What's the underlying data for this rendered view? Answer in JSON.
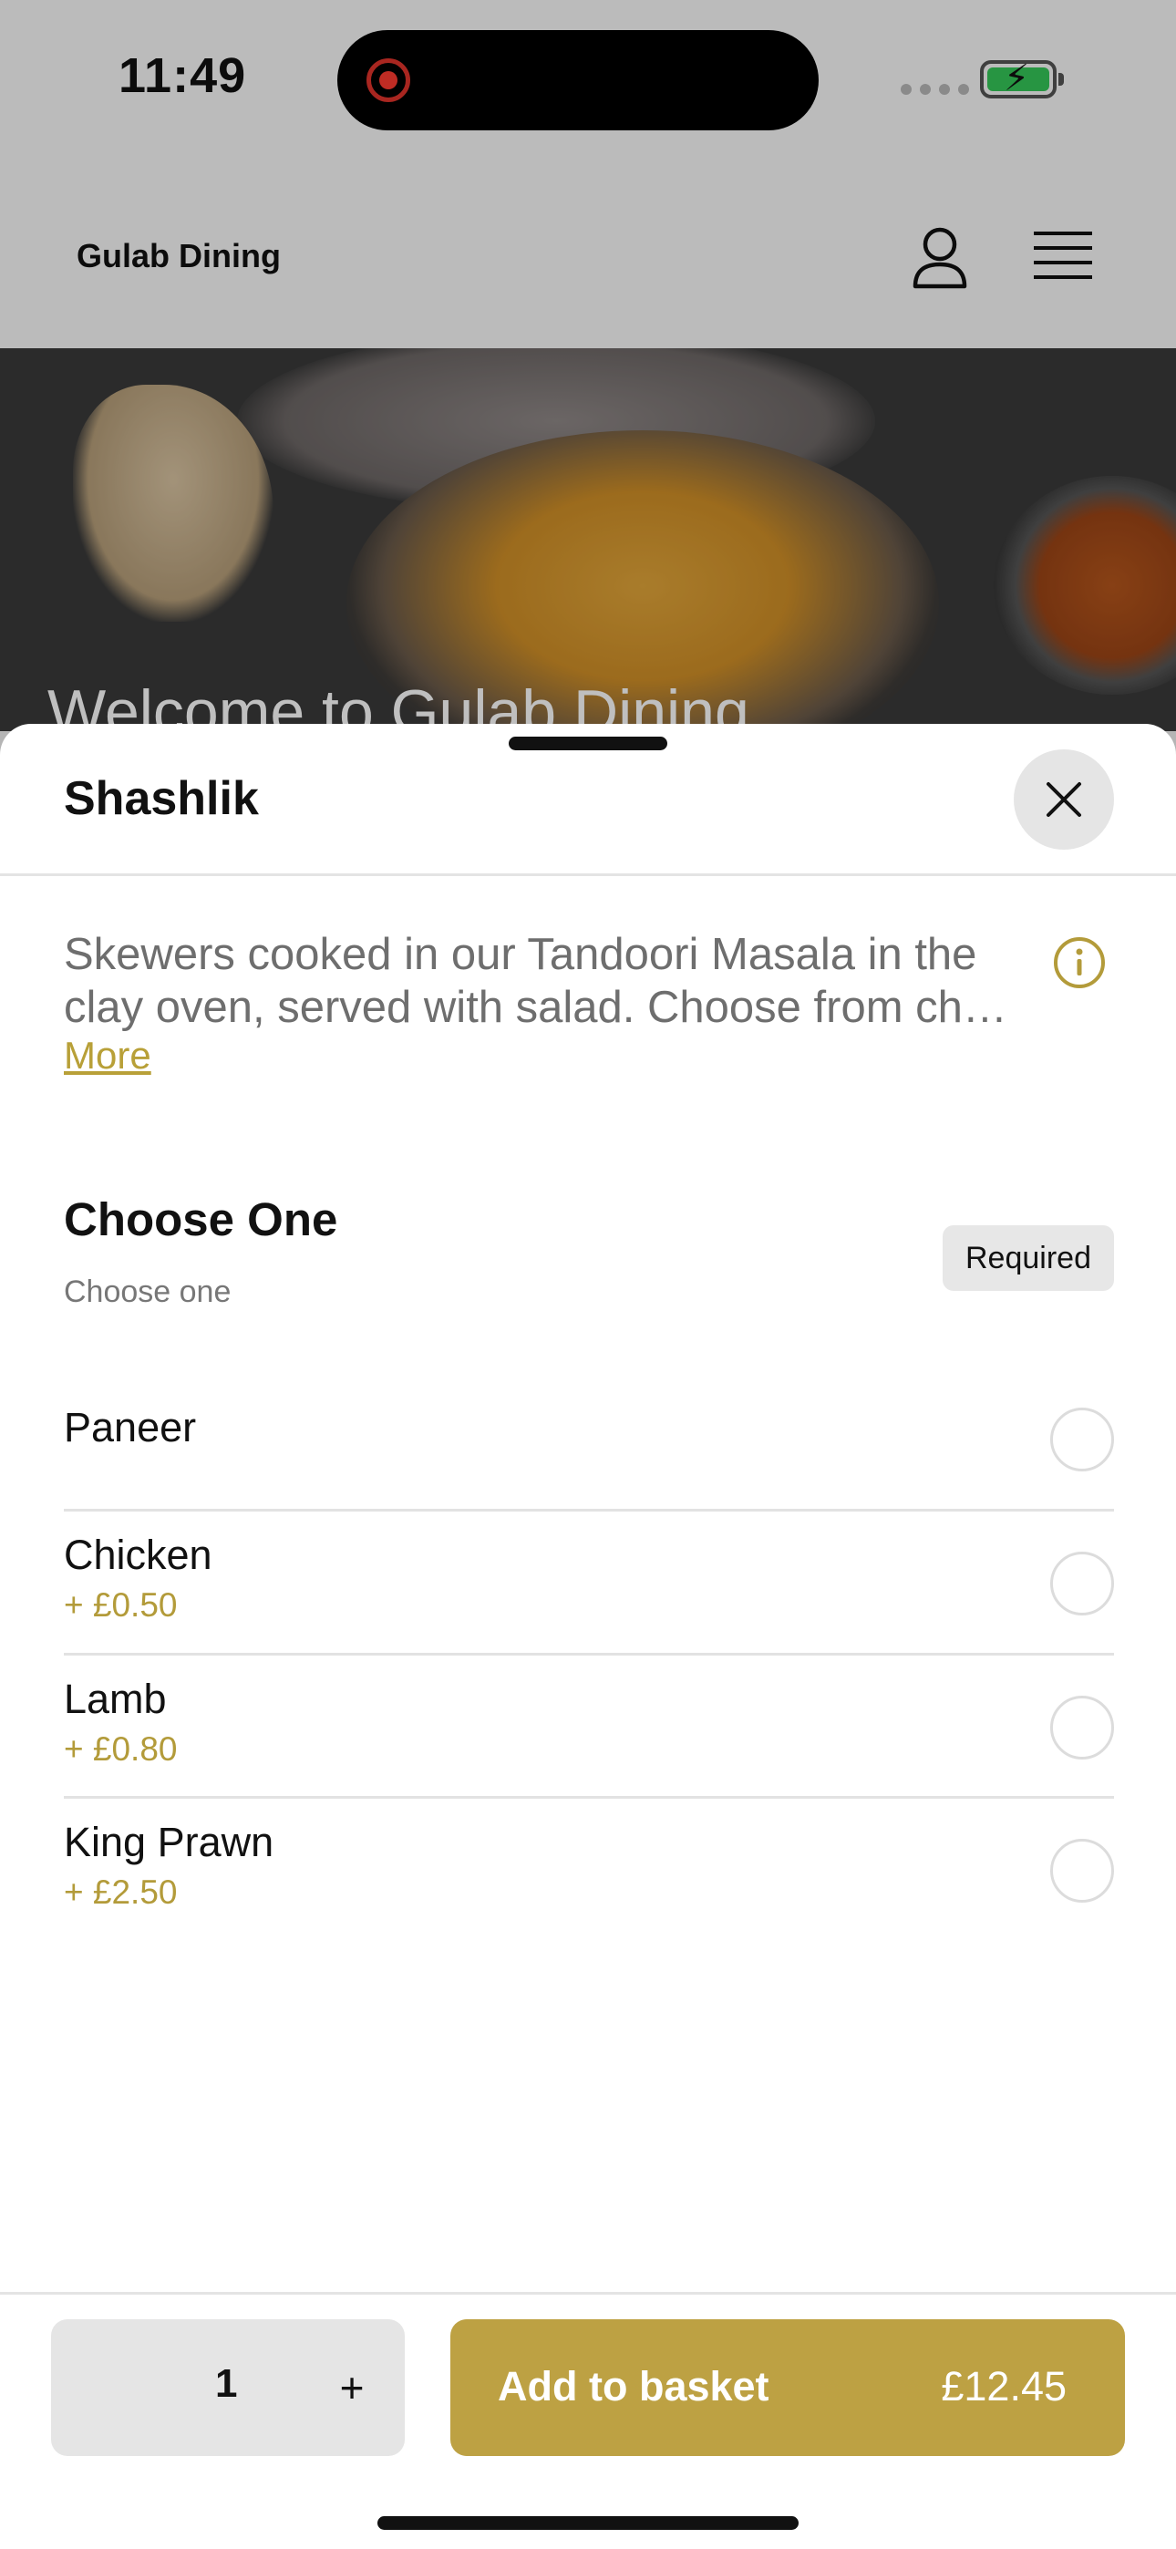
{
  "status_bar": {
    "time": "11:49"
  },
  "header": {
    "brand": "Gulab Dining"
  },
  "hero": {
    "title": "Welcome to Gulab Dining"
  },
  "sheet": {
    "title": "Shashlik",
    "description": "Skewers cooked in our Tandoori Masala in the clay oven, served with salad. Choose from ch…",
    "more_label": "More",
    "group": {
      "title": "Choose One",
      "subtitle": "Choose one",
      "badge": "Required",
      "options": [
        {
          "name": "Paneer",
          "price": ""
        },
        {
          "name": "Chicken",
          "price": "+ £0.50"
        },
        {
          "name": "Lamb",
          "price": "+ £0.80"
        },
        {
          "name": "King Prawn",
          "price": "+ £2.50"
        }
      ]
    }
  },
  "footer": {
    "quantity": "1",
    "plus_label": "+",
    "add_label": "Add to basket",
    "total": "£12.45"
  },
  "colors": {
    "accent": "#bda143",
    "price_text": "#b39b3a"
  },
  "icons": [
    "record-icon",
    "signal-icon",
    "battery-charging-icon",
    "account-icon",
    "menu-icon",
    "close-icon",
    "info-icon"
  ]
}
